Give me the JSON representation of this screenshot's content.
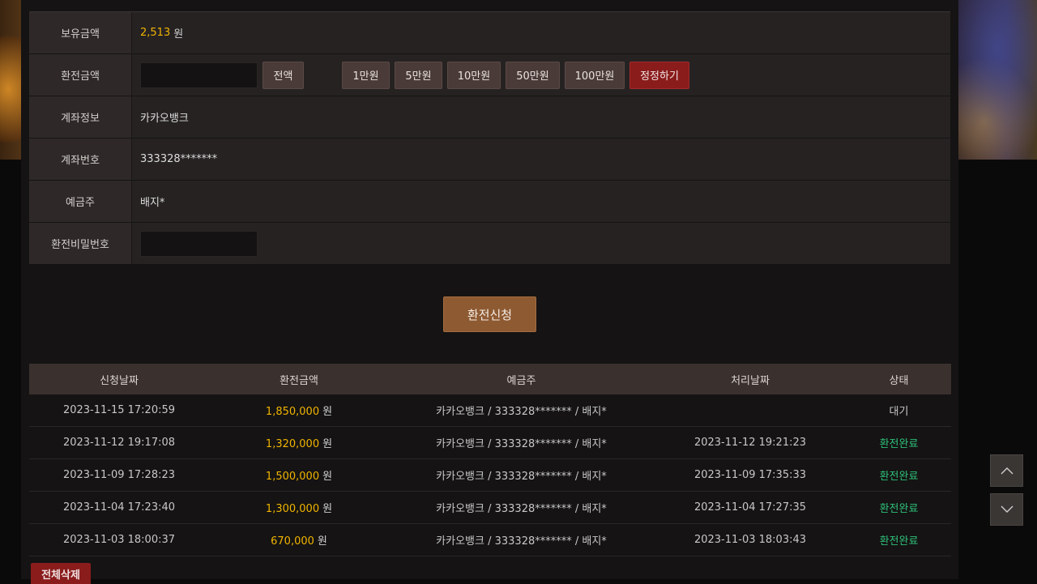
{
  "form": {
    "balance": {
      "label": "보유금액",
      "value": "2,513",
      "unit": "원"
    },
    "amount": {
      "label": "환전금액",
      "value": "",
      "buttons": {
        "all": "전액",
        "b1": "1만원",
        "b2": "5만원",
        "b3": "10만원",
        "b4": "50만원",
        "b5": "100만원",
        "reset": "정정하기"
      }
    },
    "bank": {
      "label": "계좌정보",
      "value": "카카오뱅크"
    },
    "account": {
      "label": "계좌번호",
      "value": "333328*******"
    },
    "holder": {
      "label": "예금주",
      "value": "배지*"
    },
    "password": {
      "label": "환전비밀번호",
      "value": ""
    }
  },
  "submit_label": "환전신청",
  "table": {
    "headers": {
      "date": "신청날짜",
      "amount": "환전금액",
      "holder": "예금주",
      "processed": "처리날짜",
      "status": "상태"
    },
    "unit": "원",
    "rows": [
      {
        "date": "2023-11-15 17:20:59",
        "amount": "1,850,000",
        "holder": "카카오뱅크 / 333328******* / 배지*",
        "processed": "",
        "status": "대기"
      },
      {
        "date": "2023-11-12 19:17:08",
        "amount": "1,320,000",
        "holder": "카카오뱅크 / 333328******* / 배지*",
        "processed": "2023-11-12 19:21:23",
        "status": "환전완료"
      },
      {
        "date": "2023-11-09 17:28:23",
        "amount": "1,500,000",
        "holder": "카카오뱅크 / 333328******* / 배지*",
        "processed": "2023-11-09 17:35:33",
        "status": "환전완료"
      },
      {
        "date": "2023-11-04 17:23:40",
        "amount": "1,300,000",
        "holder": "카카오뱅크 / 333328******* / 배지*",
        "processed": "2023-11-04 17:27:35",
        "status": "환전완료"
      },
      {
        "date": "2023-11-03 18:00:37",
        "amount": "670,000",
        "holder": "카카오뱅크 / 333328******* / 배지*",
        "processed": "2023-11-03 18:03:43",
        "status": "환전완료"
      }
    ]
  },
  "delete_all_label": "전체삭제",
  "icons": {
    "scroll_up": "chevron-up-icon",
    "scroll_down": "chevron-down-icon"
  },
  "colors": {
    "accent_gold": "#f0b400",
    "status_done": "#2ec07a",
    "danger": "#8a1c1c",
    "submit": "#8e5a32"
  }
}
